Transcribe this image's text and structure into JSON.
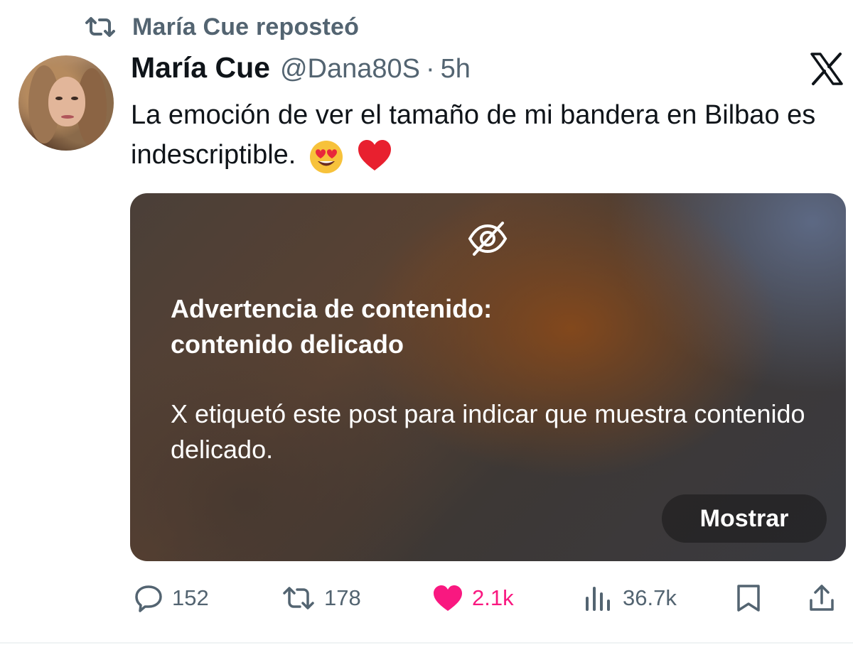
{
  "repost": {
    "label": "María Cue reposteó",
    "icon": "repost-icon"
  },
  "author": {
    "name": "María Cue",
    "handle": "@Dana80S",
    "separator": "·",
    "time": "5h"
  },
  "platform_logo": "x-logo",
  "tweet": {
    "text": "La emoción de ver el tamaño de mi bandera en Bilbao es indescriptible.",
    "emojis": [
      "smiling-face-with-heart-eyes",
      "red-heart"
    ]
  },
  "media_warning": {
    "icon": "eye-slash-icon",
    "title_line1": "Advertencia de contenido:",
    "title_line2": "contenido delicado",
    "body": "X etiquetó este post para indicar que muestra contenido delicado.",
    "button": "Mostrar"
  },
  "actions": {
    "replies": "152",
    "reposts": "178",
    "likes": "2.1k",
    "views": "36.7k"
  },
  "colors": {
    "text": "#0f1419",
    "secondary": "#536471",
    "like": "#f91880"
  }
}
